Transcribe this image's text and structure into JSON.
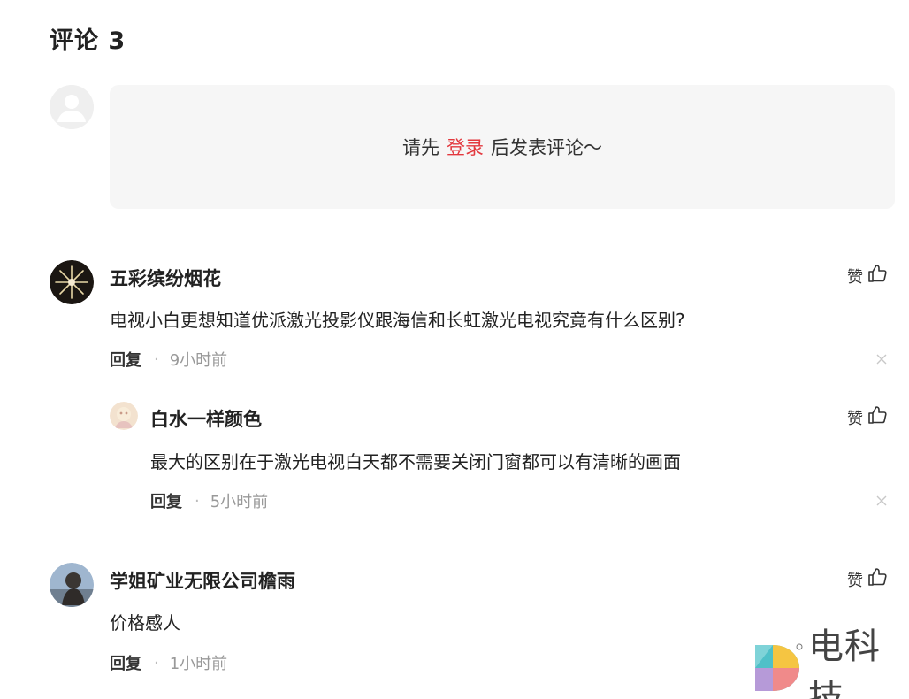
{
  "header": {
    "title": "评论 3"
  },
  "login_prompt": {
    "before": "请先",
    "link": "登录",
    "after": "后发表评论～"
  },
  "comments": [
    {
      "user": "五彩缤纷烟花",
      "text": "电视小白更想知道优派激光投影仪跟海信和长虹激光电视究竟有什么区别?",
      "reply_label": "回复",
      "separator": "·",
      "time": "9小时前",
      "like_label": "赞"
    },
    {
      "user": "白水一样颜色",
      "text": "最大的区别在于激光电视白天都不需要关闭门窗都可以有清晰的画面",
      "reply_label": "回复",
      "separator": "·",
      "time": "5小时前",
      "like_label": "赞"
    },
    {
      "user": "学姐矿业无限公司檐雨",
      "text": "价格感人",
      "reply_label": "回复",
      "separator": "·",
      "time": "1小时前",
      "like_label": "赞"
    }
  ],
  "brand": {
    "text": "电科技"
  },
  "icons": {
    "like": "thumbs-up-icon",
    "close": "close-icon",
    "default_avatar": "default-avatar-icon"
  },
  "colors": {
    "accent": "#e3383e",
    "muted": "#999999",
    "panel": "#f6f6f6"
  }
}
